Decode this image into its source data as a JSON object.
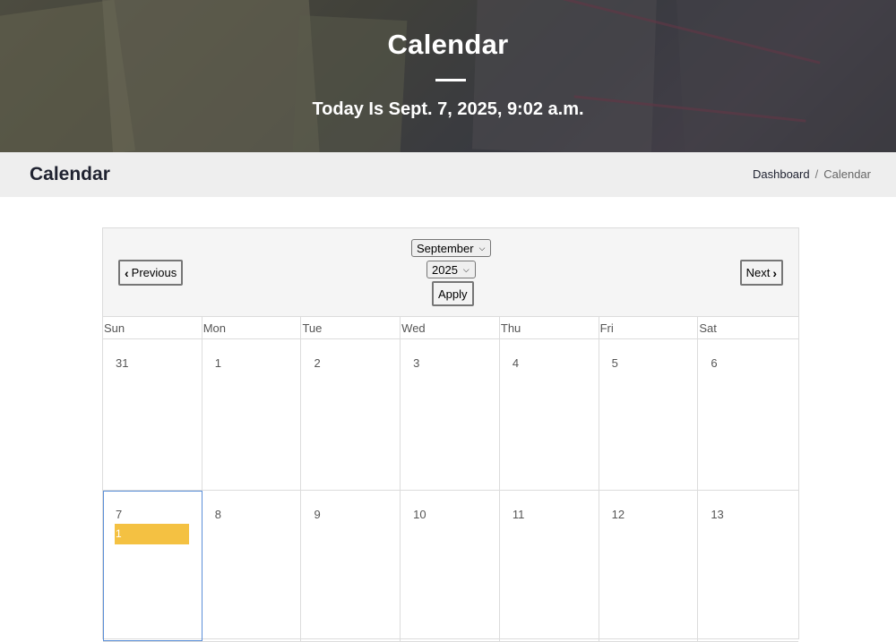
{
  "hero": {
    "title": "Calendar",
    "subtitle": "Today Is Sept. 7, 2025, 9:02 a.m."
  },
  "header": {
    "page_title": "Calendar",
    "breadcrumb": {
      "items": [
        "Dashboard",
        "Calendar"
      ],
      "separator": "/"
    }
  },
  "calendar": {
    "prev_label": "Previous",
    "next_label": "Next",
    "month_select": "September",
    "year_select": "2025",
    "apply_label": "Apply",
    "weekdays": [
      "Sun",
      "Mon",
      "Tue",
      "Wed",
      "Thu",
      "Fri",
      "Sat"
    ],
    "weeks": [
      [
        "31",
        "1",
        "2",
        "3",
        "4",
        "5",
        "6"
      ],
      [
        "7",
        "8",
        "9",
        "10",
        "11",
        "12",
        "13"
      ]
    ],
    "today": "7",
    "events": [
      {
        "day": "7",
        "label": "1",
        "color": "#f4c142"
      }
    ]
  },
  "colors": {
    "accent_today_border": "#5b8fd8",
    "event": "#f4c142",
    "crumb_bar": "#eeeeee"
  },
  "icons": {
    "prev": "chevron-left-icon",
    "next": "chevron-right-icon",
    "select": "chevron-down-icon"
  }
}
